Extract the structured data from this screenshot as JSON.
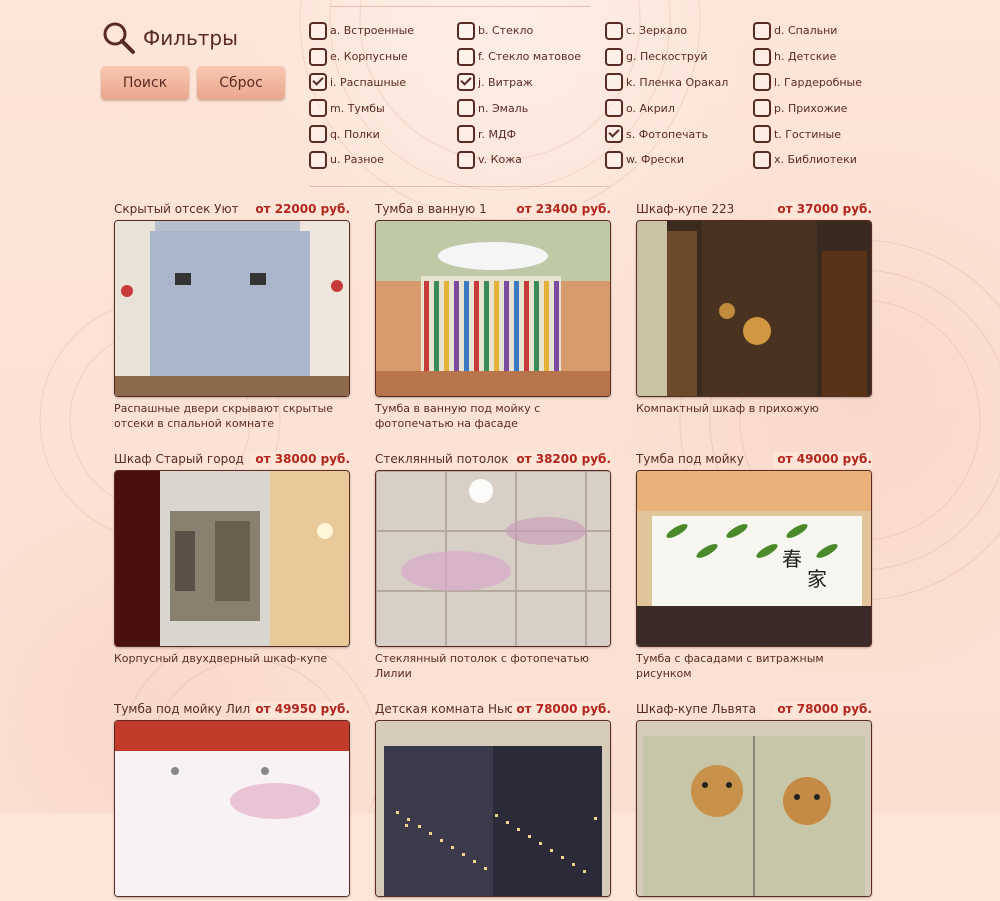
{
  "filters": {
    "title": "Фильтры",
    "search_label": "Поиск",
    "reset_label": "Сброс",
    "options": [
      {
        "label": "a. Встроенные",
        "checked": false
      },
      {
        "label": "b. Стекло",
        "checked": false
      },
      {
        "label": "c. Зеркало",
        "checked": false
      },
      {
        "label": "d. Спальни",
        "checked": false
      },
      {
        "label": "e. Корпусные",
        "checked": false
      },
      {
        "label": "f. Стекло матовое",
        "checked": false
      },
      {
        "label": "g. Пескоструй",
        "checked": false
      },
      {
        "label": "h. Детские",
        "checked": false
      },
      {
        "label": "i. Распашные",
        "checked": true
      },
      {
        "label": "j. Витраж",
        "checked": true
      },
      {
        "label": "k. Пленка Оракал",
        "checked": false
      },
      {
        "label": "l. Гардеробные",
        "checked": false
      },
      {
        "label": "m. Тумбы",
        "checked": false
      },
      {
        "label": "n. Эмаль",
        "checked": false
      },
      {
        "label": "o. Акрил",
        "checked": false
      },
      {
        "label": "p. Прихожие",
        "checked": false
      },
      {
        "label": "q. Полки",
        "checked": false
      },
      {
        "label": "r. МДФ",
        "checked": false
      },
      {
        "label": "s. Фотопечать",
        "checked": true
      },
      {
        "label": "t. Гостиные",
        "checked": false
      },
      {
        "label": "u. Разное",
        "checked": false
      },
      {
        "label": "v. Кожа",
        "checked": false
      },
      {
        "label": "w. Фрески",
        "checked": false
      },
      {
        "label": "x. Библиотеки",
        "checked": false
      }
    ]
  },
  "products": [
    {
      "name": "Скрытый отсек Уют",
      "price": "от 22000 руб.",
      "desc": "Распашные двери скрывают скрытые отсеки в спальной комнате",
      "scene": "hidden"
    },
    {
      "name": "Тумба в ванную 1",
      "price": "от 23400 руб.",
      "desc": "Тумба в ванную под мойку с фотопечатью на фасаде",
      "scene": "vanity"
    },
    {
      "name": "Шкаф-купе 223",
      "price": "от 37000 руб.",
      "desc": "Компактный шкаф в прихожую",
      "scene": "night"
    },
    {
      "name": "Шкаф Старый город",
      "price": "от 38000 руб.",
      "desc": "Корпусный двухдверный шкаф-купе",
      "scene": "city"
    },
    {
      "name": "Стеклянный потолок Лилии",
      "price": "от 38200 руб.",
      "desc": "Стеклянный потолок с фотопечатью Лилии",
      "scene": "ceiling"
    },
    {
      "name": "Тумба под мойку",
      "price": "от 49000 руб.",
      "desc": "Тумба с фасадами с витражным рисунком",
      "scene": "bamboo"
    },
    {
      "name": "Тумба под мойку Лилии",
      "price": "от 49950 руб.",
      "desc": "",
      "scene": "lily"
    },
    {
      "name": "Детская комната Нью-Йорк",
      "price": "от 78000 руб.",
      "desc": "",
      "scene": "ny"
    },
    {
      "name": "Шкаф-купе Львята",
      "price": "от 78000 руб.",
      "desc": "",
      "scene": "lions"
    }
  ],
  "colors": {
    "accent": "#b3261e",
    "text": "#5a2b22",
    "background": "#fde6d8",
    "button": "#eba88d"
  }
}
